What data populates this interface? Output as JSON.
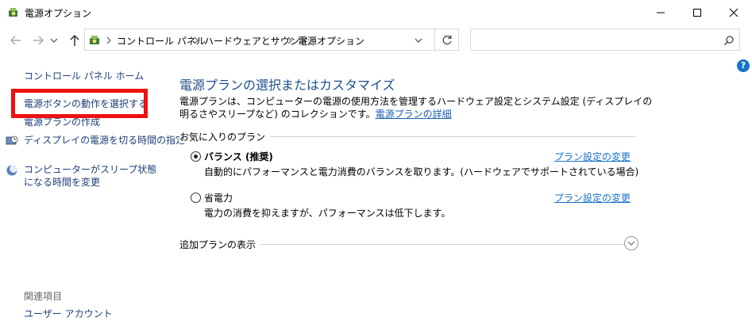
{
  "window": {
    "title": "電源オプション"
  },
  "address": {
    "crumbs": [
      "コントロール パネル",
      "ハードウェアとサウンド",
      "電源オプション"
    ]
  },
  "search": {
    "placeholder": ""
  },
  "sidebar": {
    "home": "コントロール パネル ホーム",
    "items": [
      "電源ボタンの動作を選択する",
      "電源プランの作成",
      "ディスプレイの電源を切る時間の指定",
      "コンピューターがスリープ状態になる時間を変更"
    ],
    "related_header": "関連項目",
    "related_items": [
      "ユーザー アカウント"
    ]
  },
  "main": {
    "title": "電源プランの選択またはカスタマイズ",
    "description": "電源プランは、コンピューターの電源の使用方法を管理するハードウェア設定とシステム設定 (ディスプレイの明るさやスリープなど) のコレクションです。",
    "description_link": "電源プランの詳細",
    "favorites_label": "お気に入りのプラン",
    "plans": [
      {
        "name": "バランス (推奨)",
        "desc": "自動的にパフォーマンスと電力消費のバランスを取ります。(ハードウェアでサポートされている場合)",
        "link": "プラン設定の変更",
        "selected": true
      },
      {
        "name": "省電力",
        "desc": "電力の消費を抑えますが、パフォーマンスは低下します。",
        "link": "プラン設定の変更",
        "selected": false
      }
    ],
    "additional_label": "追加プランの表示"
  },
  "colors": {
    "accent": "#1e4e8c",
    "link": "#1a73c8",
    "highlight": "#ee1111"
  }
}
